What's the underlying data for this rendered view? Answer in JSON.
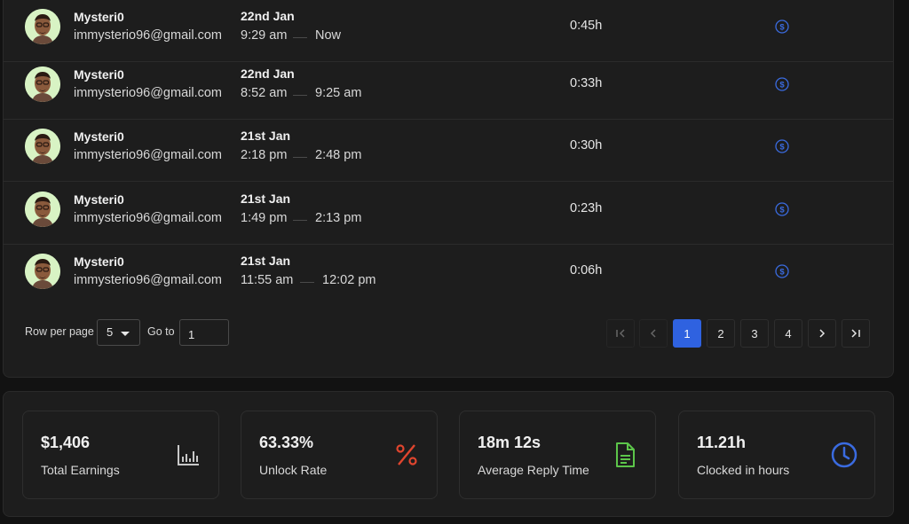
{
  "rows": [
    {
      "name": "Mysteri0",
      "email": "immysterio96@gmail.com",
      "date": "22nd Jan",
      "start": "9:29 am",
      "end": "Now",
      "duration": "0:45h"
    },
    {
      "name": "Mysteri0",
      "email": "immysterio96@gmail.com",
      "date": "22nd Jan",
      "start": "8:52 am",
      "end": "9:25 am",
      "duration": "0:33h"
    },
    {
      "name": "Mysteri0",
      "email": "immysterio96@gmail.com",
      "date": "21st Jan",
      "start": "2:18 pm",
      "end": "2:48 pm",
      "duration": "0:30h"
    },
    {
      "name": "Mysteri0",
      "email": "immysterio96@gmail.com",
      "date": "21st Jan",
      "start": "1:49 pm",
      "end": "2:13 pm",
      "duration": "0:23h"
    },
    {
      "name": "Mysteri0",
      "email": "immysterio96@gmail.com",
      "date": "21st Jan",
      "start": "11:55 am",
      "end": "12:02 pm",
      "duration": "0:06h"
    }
  ],
  "pagination": {
    "rows_per_page_label": "Row per page",
    "rows_per_page_value": "5",
    "goto_label": "Go to",
    "goto_value": "1",
    "pages": [
      "1",
      "2",
      "3",
      "4"
    ],
    "current_page": "1"
  },
  "stats": [
    {
      "value": "$1,406",
      "label": "Total Earnings",
      "icon": "bar-chart-icon",
      "color": "#c8c8c8"
    },
    {
      "value": "63.33%",
      "label": "Unlock Rate",
      "icon": "percent-icon",
      "color": "#e0452e"
    },
    {
      "value": "18m 12s",
      "label": "Average Reply Time",
      "icon": "document-icon",
      "color": "#5cc54a"
    },
    {
      "value": "11.21h",
      "label": "Clocked in hours",
      "icon": "clock-icon",
      "color": "#3a6be0"
    }
  ],
  "colors": {
    "accent": "#2f62e0",
    "coin": "#3a6be0"
  }
}
